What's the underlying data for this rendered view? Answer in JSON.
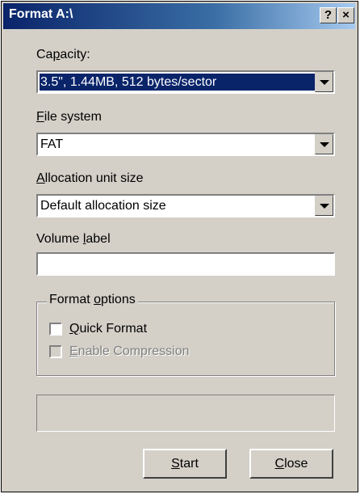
{
  "window": {
    "title": "Format A:\\",
    "help_button": "?",
    "close_button": "×"
  },
  "capacity": {
    "label_pre": "Ca",
    "label_u": "p",
    "label_post": "acity:",
    "value": "3.5\",  1.44MB, 512 bytes/sector"
  },
  "file_system": {
    "label_u": "F",
    "label_post": "ile system",
    "value": "FAT"
  },
  "allocation": {
    "label_u": "A",
    "label_post": "llocation unit size",
    "value": "Default allocation size"
  },
  "volume_label": {
    "label_pre": "Volume ",
    "label_u": "l",
    "label_post": "abel",
    "value": ""
  },
  "format_options": {
    "legend_pre": "Format ",
    "legend_u": "o",
    "legend_post": "ptions",
    "quick_format": {
      "label_u": "Q",
      "label_post": "uick Format",
      "checked": false,
      "enabled": true
    },
    "enable_compression": {
      "label_u": "E",
      "label_post": "nable Compression",
      "checked": false,
      "enabled": false
    }
  },
  "buttons": {
    "start": {
      "label_u": "S",
      "label_post": "tart"
    },
    "close": {
      "label_u": "C",
      "label_post": "lose"
    }
  },
  "colors": {
    "title_bar": "#0a246a",
    "face": "#d4d0c8",
    "selection": "#0a246a"
  }
}
